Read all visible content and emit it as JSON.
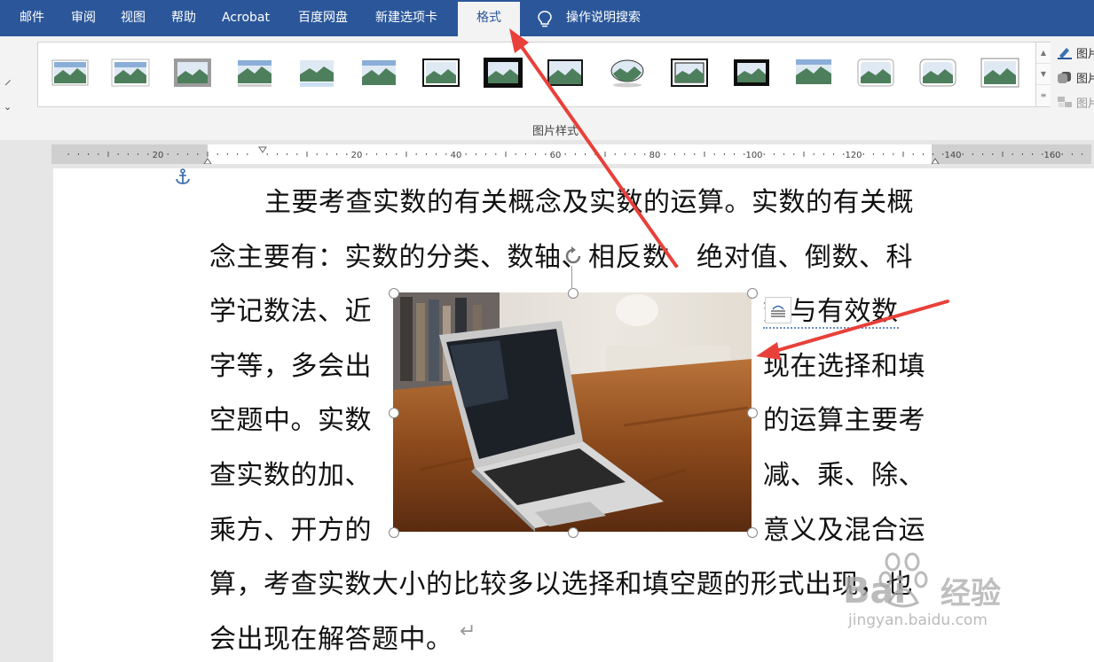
{
  "ribbon_tabs": {
    "mail": "邮件",
    "review": "审阅",
    "view": "视图",
    "help": "帮助",
    "acrobat": "Acrobat",
    "baidu_pan": "百度网盘",
    "new_tab": "新建选项卡",
    "format": "格式",
    "search": "操作说明搜索"
  },
  "ribbon": {
    "group_label": "图片样式",
    "side_items": [
      "图片",
      "图片",
      "图片"
    ]
  },
  "ruler": {
    "labels_left": [
      "20"
    ],
    "labels_main": [
      "20",
      "40",
      "60",
      "80",
      "100",
      "120",
      "140"
    ],
    "labels_right": [
      "160"
    ]
  },
  "document": {
    "lines": [
      "主要考查实数的有关概念及实数的运算。实数的有关概",
      "念主要有：实数的分类、数轴、相反数、绝对值、倒数、科",
      "学记数法、近",
      "数与有效数",
      "字等，多会出",
      "现在选择和填",
      "空题中。实数",
      "的运算主要考",
      "查实数的加、",
      "减、乘、除、",
      "乘方、开方的",
      "意义及混合运",
      "算，考查实数大小的比较多以选择和填空题的形式出现，也",
      "会出现在解答题中。",
      "↵"
    ]
  },
  "watermark": {
    "brand": "经验",
    "url": "jingyan.baidu.com"
  },
  "colors": {
    "ribbon_blue": "#2b579a",
    "annotation_red": "#e8403a"
  }
}
